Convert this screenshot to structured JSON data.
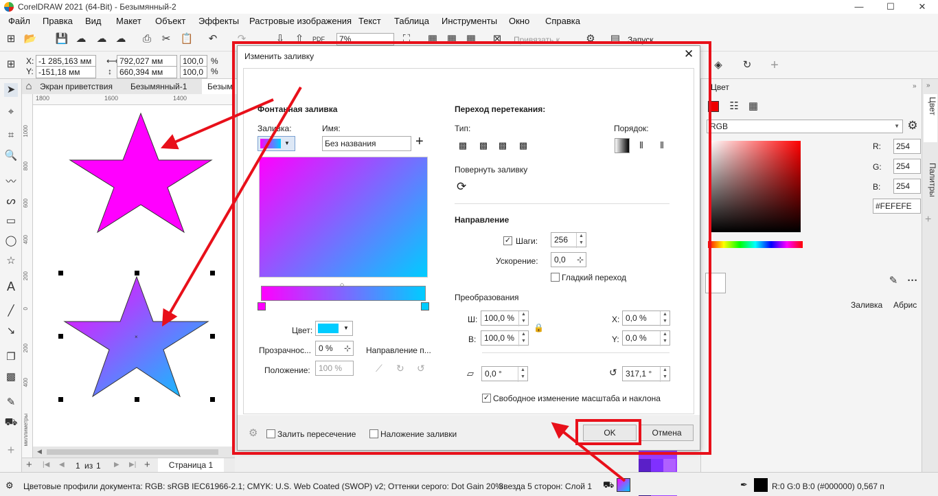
{
  "window": {
    "title": "CorelDRAW 2021 (64-Bit) - Безымянный-2",
    "min": "—",
    "max": "☐",
    "close": "✕"
  },
  "menu": [
    "Файл",
    "Правка",
    "Вид",
    "Макет",
    "Объект",
    "Эффекты",
    "Растровые изображения",
    "Текст",
    "Таблица",
    "Инструменты",
    "Окно",
    "Справка"
  ],
  "toolbar": {
    "zoom": "7%",
    "snap": "Привязать к",
    "launch": "Запуск"
  },
  "props": {
    "x": "-1 285,163 мм",
    "y": "-151,18 мм",
    "w": "792,027 мм",
    "h": "660,394 мм",
    "sx": "100,0",
    "sy": "100,0",
    "pct": "%"
  },
  "tabs": {
    "welcome": "Экран приветствия",
    "doc": "Безымянный-1",
    "doc2": "Безым"
  },
  "ruler": {
    "top": [
      "1800",
      "1600",
      "1400"
    ],
    "left_unit": "миллиметры",
    "left": [
      "1000",
      "800",
      "600",
      "400",
      "200",
      "0",
      "200",
      "400"
    ]
  },
  "pagenav": {
    "current": "1",
    "of": "из",
    "total": "1",
    "page": "Страница 1"
  },
  "status": {
    "profiles": "Цветовые профили документа: RGB: sRGB IEC61966-2.1; CMYK: U.S. Web Coated (SWOP) v2; Оттенки серого: Dot Gain 20%",
    "object": "Звезда  5 сторон: Слой 1",
    "fill": "R:0 G:0 B:0 (#000000)  0,567 п"
  },
  "color_docker": {
    "title": "Цвет",
    "model": "RGB",
    "r_label": "R:",
    "g_label": "G:",
    "b_label": "B:",
    "r": "254",
    "g": "254",
    "b": "254",
    "hex": "#FEFEFE",
    "fill_label": "Заливка",
    "outline_label": "Абрис"
  },
  "docker_tabs": {
    "color": "Цвет",
    "palettes": "Палитры"
  },
  "dialog": {
    "title": "Изменить заливку",
    "section_fountain": "Фонтанная заливка",
    "fill_label": "Заливка:",
    "name_label": "Имя:",
    "name_value": "Без названия",
    "color_label": "Цвет:",
    "transparency_label": "Прозрачнос...",
    "transparency_value": "0 %",
    "position_label": "Положение:",
    "position_value": "100 %",
    "direction_label": "Направление п...",
    "blend_title": "Переход перетекания:",
    "type_label": "Тип:",
    "order_label": "Порядок:",
    "rotate_label": "Повернуть заливку",
    "direction_title": "Направление",
    "steps_label": "Шаги:",
    "steps_value": "256",
    "accel_label": "Ускорение:",
    "accel_value": "0,0",
    "smooth_label": "Гладкий переход",
    "transform_title": "Преобразования",
    "w_label": "Ш:",
    "w_value": "100,0 %",
    "h_label": "В:",
    "h_value": "100,0 %",
    "x_label": "X:",
    "x_value": "0,0 %",
    "y_label": "Y:",
    "y_value": "0,0 %",
    "skew_value": "0,0 °",
    "rot_value": "317,1 °",
    "free_scale_label": "Свободное изменение масштаба и наклона",
    "intersect_label": "Залить пересечение",
    "overprint_label": "Наложение заливки",
    "ok": "OK",
    "cancel": "Отмена"
  },
  "colors": {
    "accent": "#e8101a",
    "grad_start": "#ff00ff",
    "grad_end": "#00ccff",
    "magenta": "#ff00ff"
  }
}
